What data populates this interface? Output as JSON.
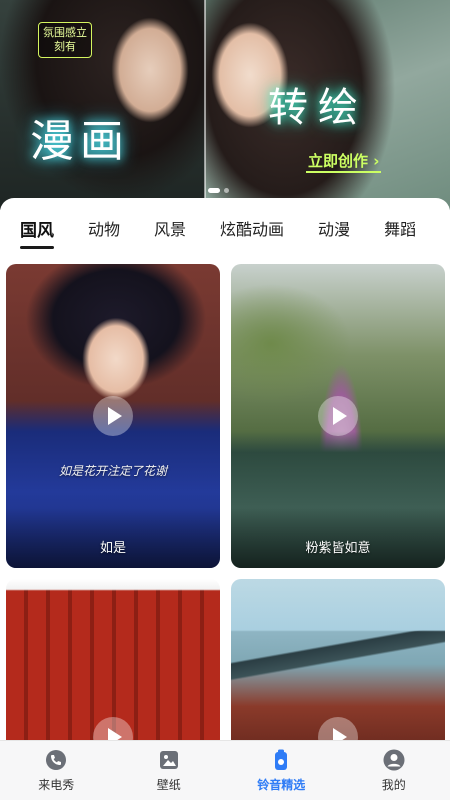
{
  "banner": {
    "tag_text": "氛围感立刻有",
    "left_title": "漫画",
    "right_title": "转绘",
    "cta_label": "立即创作 ›",
    "slides": 2,
    "active_slide": 1
  },
  "tabs": [
    {
      "label": "国风",
      "active": true
    },
    {
      "label": "动物",
      "active": false
    },
    {
      "label": "风景",
      "active": false
    },
    {
      "label": "炫酷动画",
      "active": false
    },
    {
      "label": "动漫",
      "active": false
    },
    {
      "label": "舞蹈",
      "active": false
    }
  ],
  "cards": [
    {
      "title": "如是",
      "lyric": "如是花开注定了花谢",
      "icon": "play-icon"
    },
    {
      "title": "粉紫皆如意",
      "lyric": "",
      "icon": "play-icon"
    },
    {
      "title": "",
      "lyric": "",
      "icon": "play-icon"
    },
    {
      "title": "",
      "lyric": "",
      "icon": "play-icon"
    }
  ],
  "nav": [
    {
      "label": "来电秀",
      "icon": "phone-icon",
      "active": false
    },
    {
      "label": "壁纸",
      "icon": "wallpaper-icon",
      "active": false
    },
    {
      "label": "铃音精选",
      "icon": "ringtone-icon",
      "active": true
    },
    {
      "label": "我的",
      "icon": "profile-icon",
      "active": false
    }
  ],
  "colors": {
    "accent": "#2f7cf6",
    "cta": "#ccff63",
    "tag_border": "#d4f55f"
  }
}
